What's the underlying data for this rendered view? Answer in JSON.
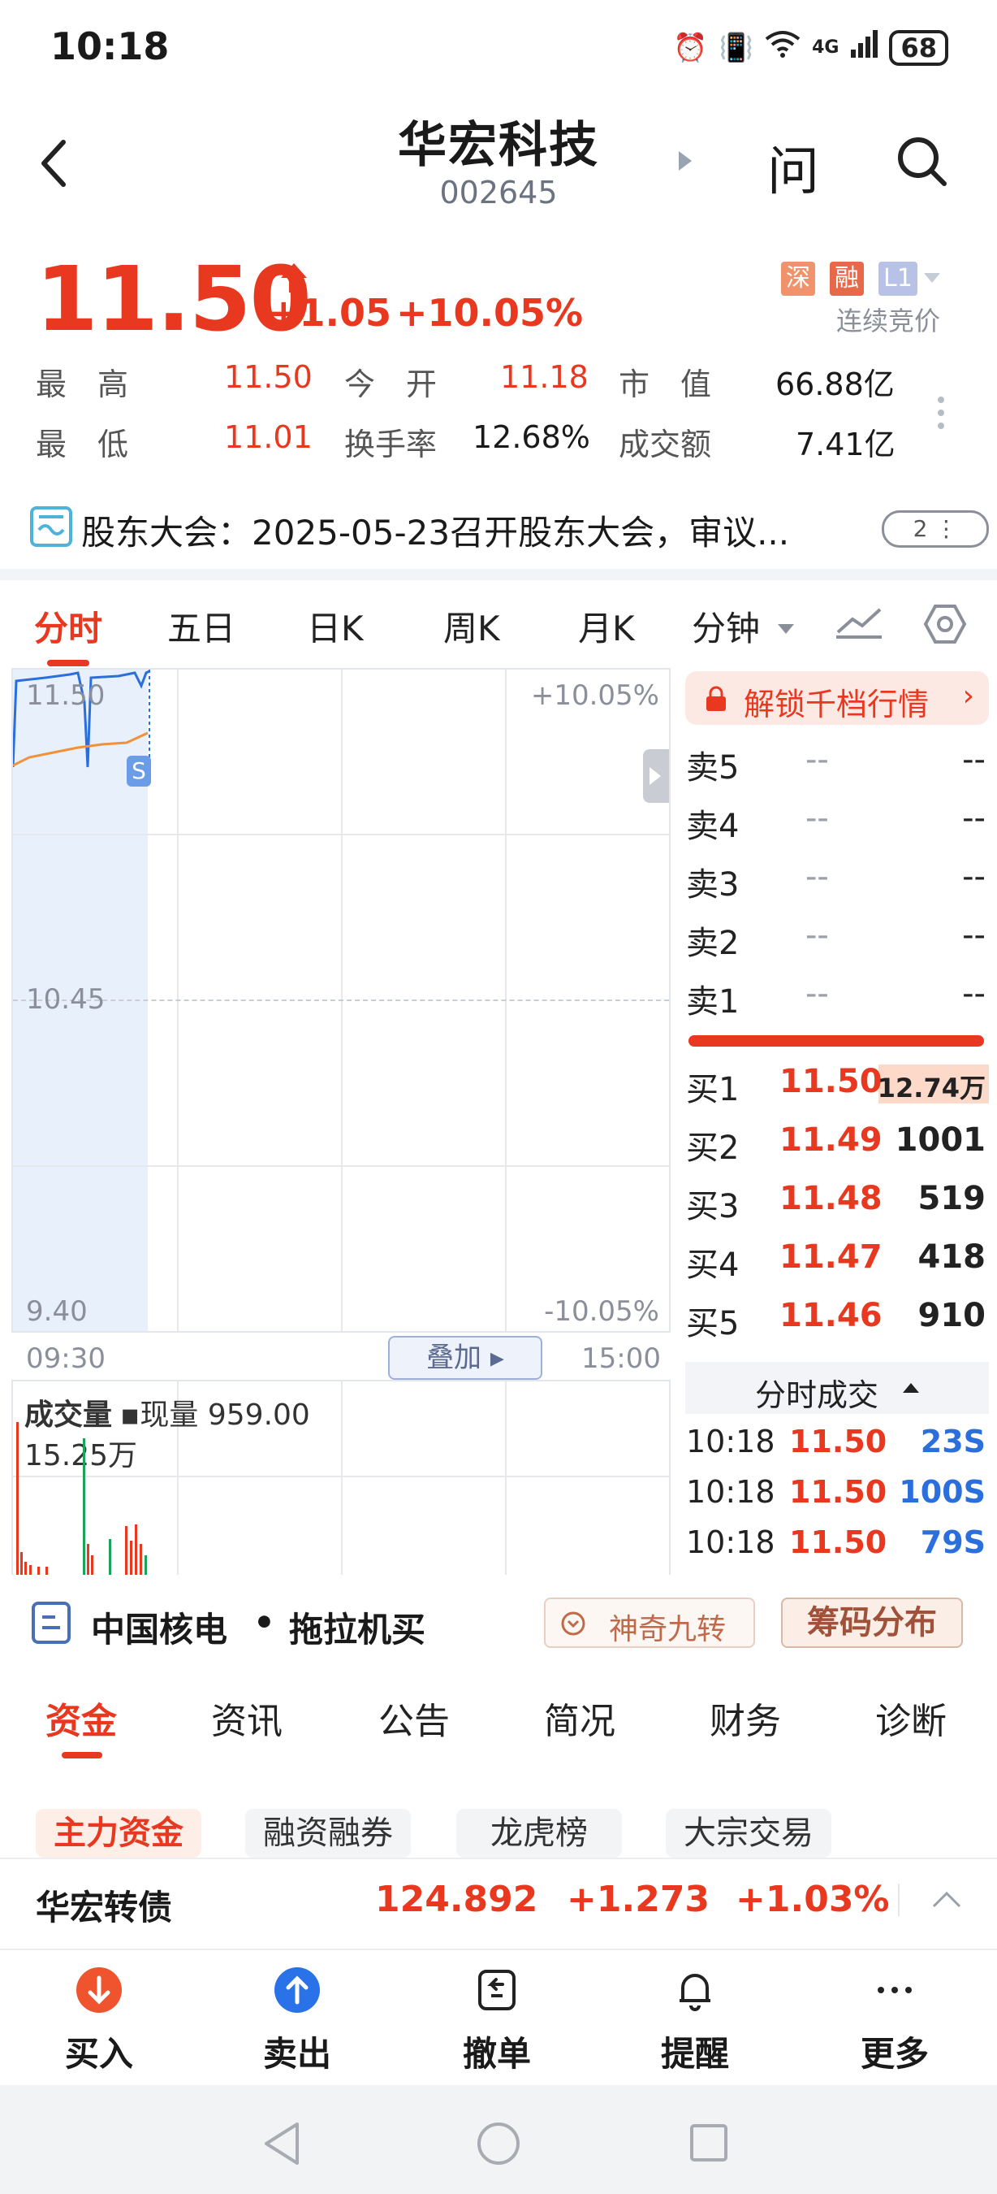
{
  "status_bar": {
    "time": "10:18",
    "network": "4G",
    "battery": "68"
  },
  "header": {
    "title": "华宏科技",
    "code": "002645",
    "ask_label": "问"
  },
  "quote": {
    "price": "11.50",
    "change": "+1.05",
    "change_pct": "+10.05%",
    "tags": [
      "深",
      "融",
      "L1"
    ],
    "auction_status": "连续竞价",
    "stats": {
      "high_label": "最　高",
      "high": "11.50",
      "open_label": "今　开",
      "open": "11.18",
      "mcap_label": "市　值",
      "mcap": "66.88亿",
      "low_label": "最　低",
      "low": "11.01",
      "turnover_label": "换手率",
      "turnover": "12.68%",
      "amount_label": "成交额",
      "amount": "7.41亿"
    }
  },
  "notice": {
    "text": "股东大会：2025-05-23召开股东大会，审议...",
    "count": "2"
  },
  "chart_tabs": [
    "分时",
    "五日",
    "日K",
    "周K",
    "月K",
    "分钟"
  ],
  "chart": {
    "price_top": "11.50",
    "price_mid": "10.45",
    "price_bottom": "9.40",
    "pct_top": "+10.05%",
    "pct_bottom": "-10.05%",
    "time_start": "09:30",
    "time_end": "15:00",
    "overlay_label": "叠加",
    "volume_label": "成交量",
    "current_volume": "现量 959.00",
    "volume_scale": "15.25万",
    "marker": "S"
  },
  "orderbook": {
    "unlock_label": "解锁千档行情",
    "asks": [
      {
        "label": "卖5",
        "price": "--",
        "vol": "--"
      },
      {
        "label": "卖4",
        "price": "--",
        "vol": "--"
      },
      {
        "label": "卖3",
        "price": "--",
        "vol": "--"
      },
      {
        "label": "卖2",
        "price": "--",
        "vol": "--"
      },
      {
        "label": "卖1",
        "price": "--",
        "vol": "--"
      }
    ],
    "bids": [
      {
        "label": "买1",
        "price": "11.50",
        "vol": "12.74万"
      },
      {
        "label": "买2",
        "price": "11.49",
        "vol": "1001"
      },
      {
        "label": "买3",
        "price": "11.48",
        "vol": "519"
      },
      {
        "label": "买4",
        "price": "11.47",
        "vol": "418"
      },
      {
        "label": "买5",
        "price": "11.46",
        "vol": "910"
      }
    ],
    "trades_label": "分时成交",
    "trades": [
      {
        "time": "10:18",
        "price": "11.50",
        "vol": "23S"
      },
      {
        "time": "10:18",
        "price": "11.50",
        "vol": "100S"
      },
      {
        "time": "10:18",
        "price": "11.50",
        "vol": "79S"
      }
    ]
  },
  "concepts": {
    "a": "中国核电",
    "sep": "•",
    "b": "拖拉机买",
    "nine": "神奇九转",
    "chips": "筹码分布"
  },
  "info_tabs": [
    "资金",
    "资讯",
    "公告",
    "简况",
    "财务",
    "诊断"
  ],
  "sub_chips": [
    "主力资金",
    "融资融券",
    "龙虎榜",
    "大宗交易"
  ],
  "bond": {
    "name": "华宏转债",
    "price": "124.892",
    "change": "+1.273",
    "pct": "+1.03%"
  },
  "actions": [
    "买入",
    "卖出",
    "撤单",
    "提醒",
    "更多"
  ],
  "colors": {
    "up": "#e8381f",
    "blue_area": "#e8f0fb",
    "line_price": "#2a6fdb",
    "line_avg": "#f0923a"
  }
}
